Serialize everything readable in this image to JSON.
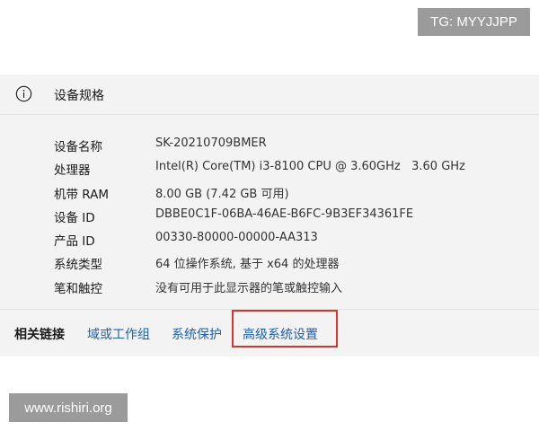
{
  "watermark_tg": "TG: MYYJJPP",
  "watermark_site": "www.rishiri.org",
  "device_specs": {
    "icon": "info-icon",
    "title": "设备规格",
    "rows": [
      {
        "label": "设备名称",
        "value": "SK-20210709BMER"
      },
      {
        "label": "处理器",
        "value": "Intel(R) Core(TM) i3-8100 CPU @ 3.60GHz   3.60 GHz"
      },
      {
        "label": "机带 RAM",
        "value": "8.00 GB (7.42 GB 可用)"
      },
      {
        "label": "设备 ID",
        "value": "DBBE0C1F-06BA-46AE-B6FC-9B3EF34361FE"
      },
      {
        "label": "产品 ID",
        "value": "00330-80000-00000-AA313"
      },
      {
        "label": "系统类型",
        "value": "64 位操作系统, 基于 x64 的处理器"
      },
      {
        "label": "笔和触控",
        "value": "没有可用于此显示器的笔或触控输入"
      }
    ]
  },
  "related_links": {
    "title": "相关链接",
    "links": [
      "域或工作组",
      "系统保护",
      "高级系统设置"
    ]
  },
  "colors": {
    "panel_bg": "#f3f3f3",
    "link": "#1a5fb4",
    "highlight": "#d9342b",
    "watermark_bg": "#9b9b9b"
  }
}
